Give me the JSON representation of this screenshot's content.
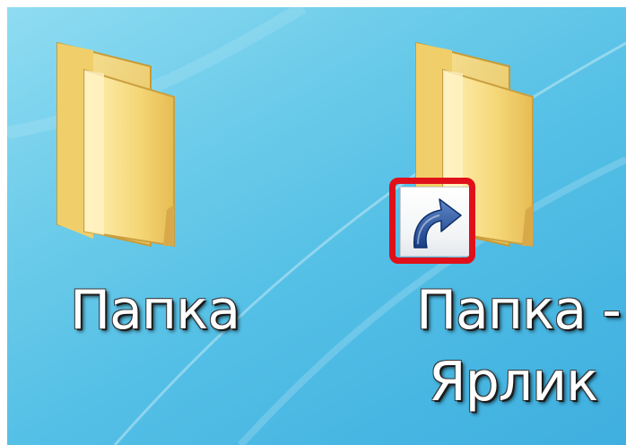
{
  "desktop": {
    "icons": [
      {
        "label": "Папка",
        "type": "folder-icon"
      },
      {
        "label_line1": "Папка -",
        "label_line2": "Ярлик",
        "type": "folder-shortcut-icon",
        "overlay": "shortcut-arrow-icon"
      }
    ],
    "highlight_color": "#e0101a",
    "folder_color": "#f3d77a"
  }
}
